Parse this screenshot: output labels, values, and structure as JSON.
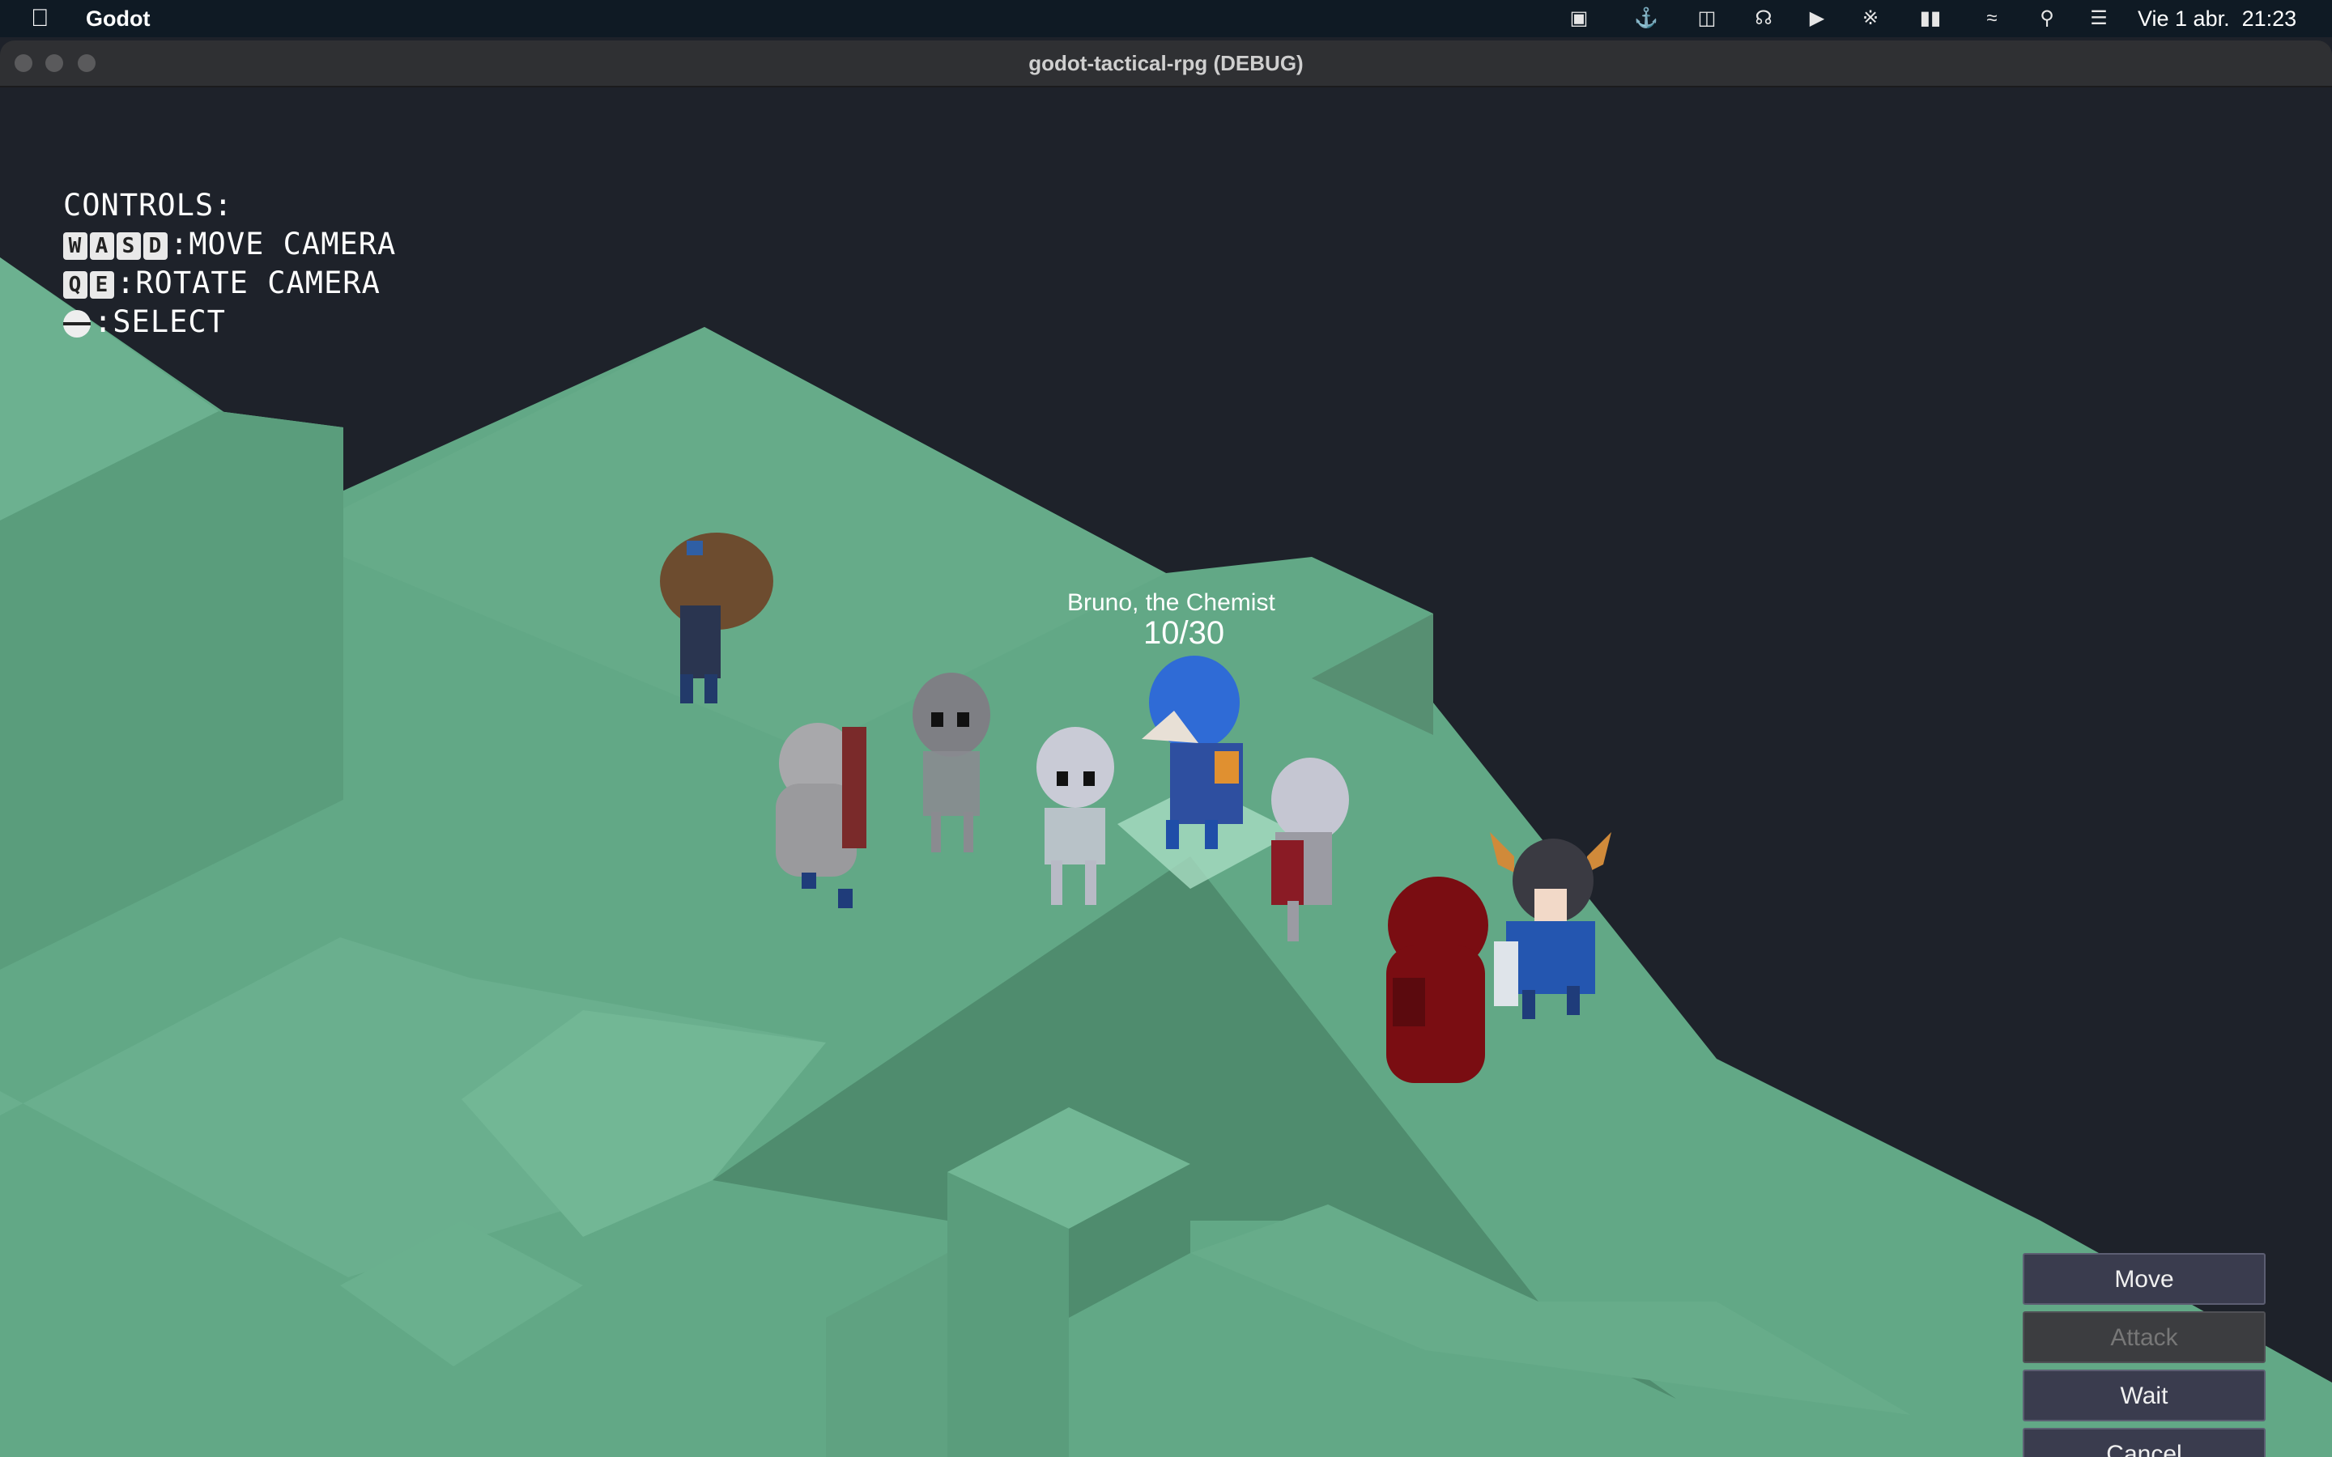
{
  "menubar": {
    "app_name": "Godot",
    "clock": "Vie 1 abr.  21:23",
    "status_icons": [
      "shield-icon",
      "docker-icon",
      "window-icon",
      "headphones-icon",
      "play-icon",
      "bluetooth-icon",
      "battery-icon",
      "wifi-icon",
      "search-icon",
      "control-center-icon"
    ]
  },
  "window": {
    "title": "godot-tactical-rpg (DEBUG)"
  },
  "controls": {
    "heading": "CONTROLS:",
    "move_keys": [
      "W",
      "A",
      "S",
      "D"
    ],
    "move_label": ":MOVE CAMERA",
    "rotate_keys": [
      "Q",
      "E"
    ],
    "rotate_label": ":ROTATE CAMERA",
    "select_label": ":SELECT"
  },
  "selected_unit": {
    "name": "Bruno, the Chemist",
    "hp": "10/30"
  },
  "action_menu": {
    "move": "Move",
    "attack": "Attack",
    "wait": "Wait",
    "cancel": "Cancel"
  },
  "colors": {
    "terrain_light": "#6fb391",
    "terrain_mid": "#5fa583",
    "terrain_dark": "#4f8c6e",
    "background": "#1e222a",
    "button_bg": "#3a3c4e"
  }
}
